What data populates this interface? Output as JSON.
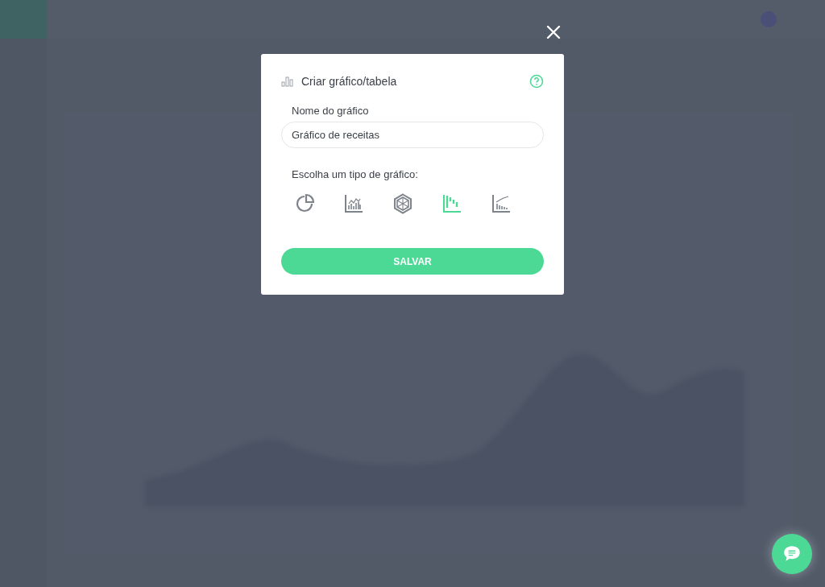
{
  "modal": {
    "title": "Criar gráfico/tabela",
    "name_label": "Nome do gráfico",
    "name_value": "Gráfico de receitas",
    "type_label": "Escolha um tipo de gráfico:",
    "chart_types": [
      {
        "kind": "pie",
        "selected": false
      },
      {
        "kind": "bar-line",
        "selected": false
      },
      {
        "kind": "radar",
        "selected": false
      },
      {
        "kind": "waterfall",
        "selected": true
      },
      {
        "kind": "combo",
        "selected": false
      }
    ],
    "save_button": "SALVAR"
  }
}
